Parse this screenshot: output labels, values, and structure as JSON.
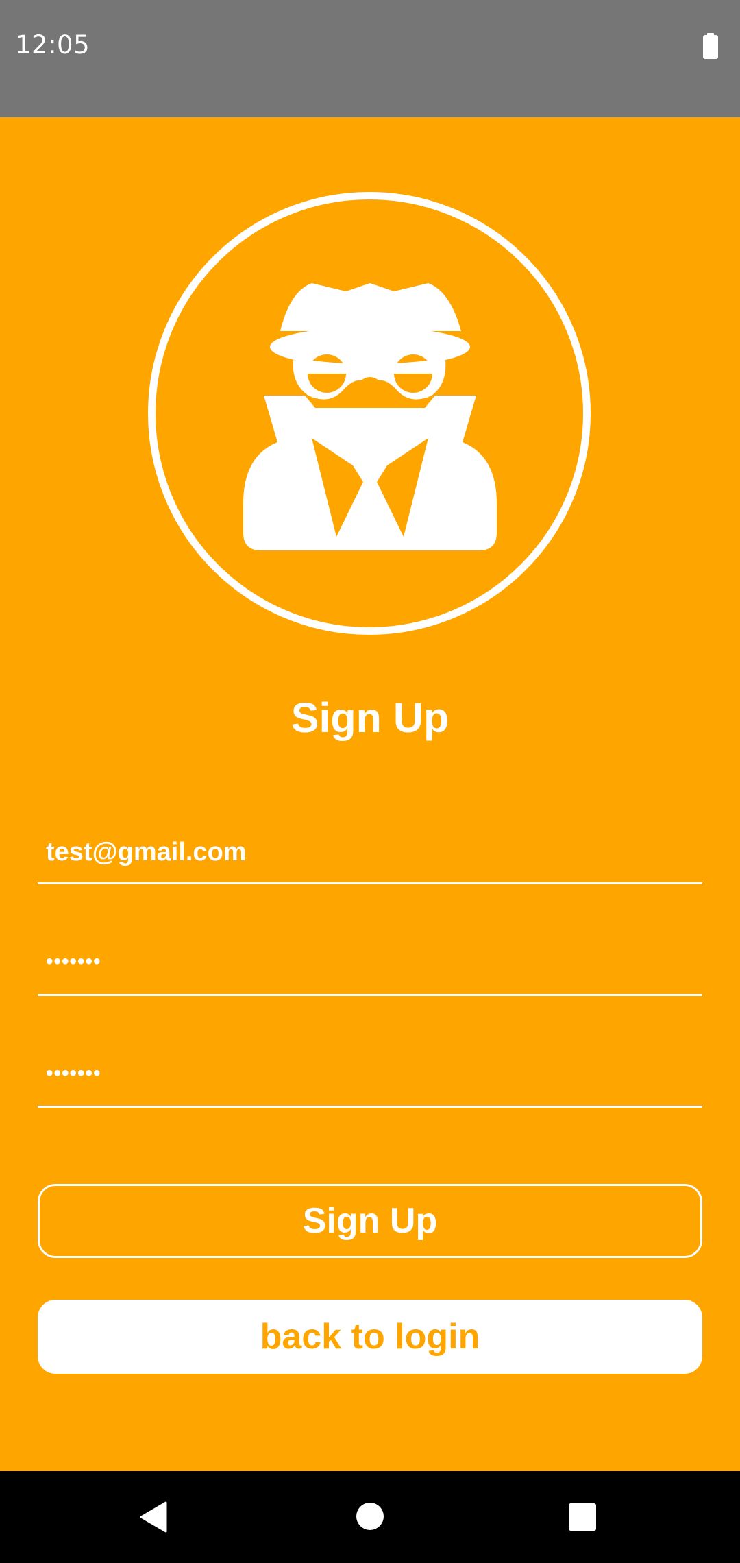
{
  "status_bar": {
    "time": "12:05",
    "icons": [
      "battery-icon"
    ]
  },
  "colors": {
    "background": "#FFA500",
    "status_bar": "#767676",
    "text": "#FFFFFF",
    "nav_bar": "#000000"
  },
  "header": {
    "avatar_icon": "spy-icon",
    "title": "Sign Up"
  },
  "form": {
    "email_value": "test@gmail.com",
    "password_value": "•••••••",
    "confirm_password_value": "•••••••"
  },
  "buttons": {
    "sign_up_label": "Sign Up",
    "back_to_login_label": "back to login"
  },
  "nav_bar": {
    "icons": [
      "back-icon",
      "home-icon",
      "recents-icon"
    ]
  }
}
